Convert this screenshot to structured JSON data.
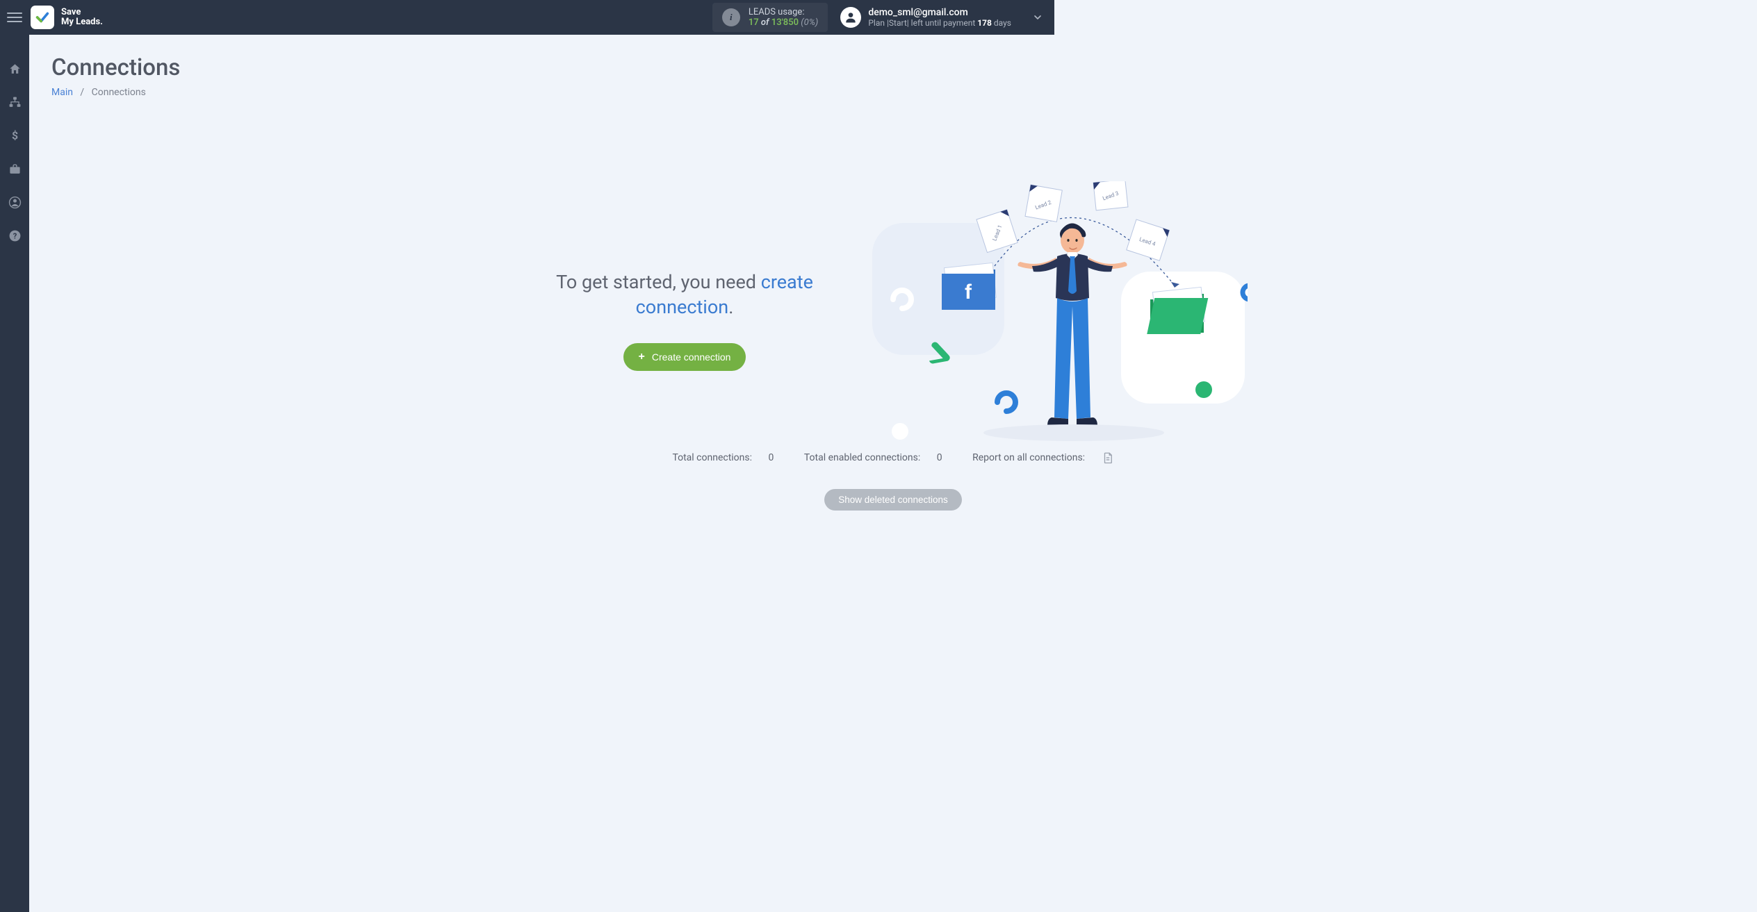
{
  "brand": {
    "line1": "Save",
    "line2": "My Leads."
  },
  "usage": {
    "label": "LEADS usage:",
    "current": "17",
    "of_word": "of",
    "total": "13'850",
    "percent": "(0%)"
  },
  "account": {
    "email": "demo_sml@gmail.com",
    "plan_prefix": "Plan |",
    "plan_name": "Start",
    "plan_mid": "| left until payment ",
    "days": "178",
    "days_word": " days"
  },
  "sidebar": {
    "items": [
      {
        "name": "home-icon"
      },
      {
        "name": "connections-icon"
      },
      {
        "name": "billing-icon"
      },
      {
        "name": "briefcase-icon"
      },
      {
        "name": "account-icon"
      },
      {
        "name": "help-icon"
      }
    ]
  },
  "page": {
    "title": "Connections",
    "breadcrumb_main": "Main",
    "breadcrumb_sep": "/",
    "breadcrumb_current": "Connections"
  },
  "cta": {
    "text_prefix": "To get started, you need ",
    "link_text": "create connection",
    "text_suffix": ".",
    "button_label": "Create connection"
  },
  "illustration": {
    "leads": [
      "Lead 1",
      "Lead 2",
      "Lead 3",
      "Lead 4"
    ],
    "facebook_icon": "f"
  },
  "stats": {
    "total_label": "Total connections: ",
    "total_value": "0",
    "enabled_label": "Total enabled connections: ",
    "enabled_value": "0",
    "report_label": "Report on all connections:"
  },
  "show_deleted_label": "Show deleted connections"
}
